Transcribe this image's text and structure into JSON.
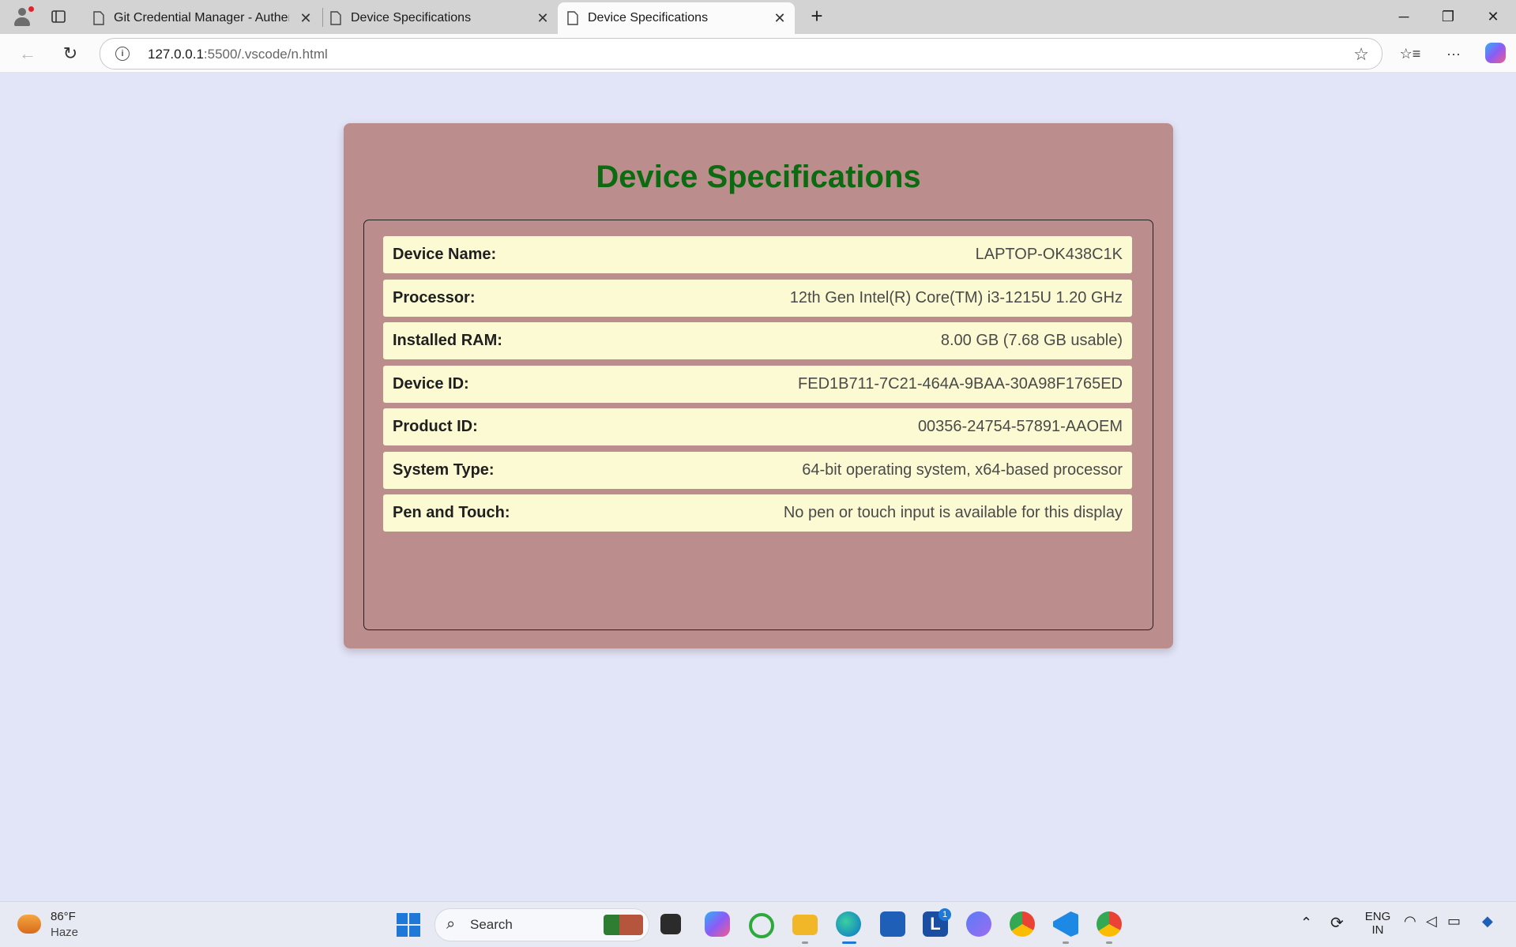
{
  "browser": {
    "tabs": [
      {
        "label": "Git Credential Manager - Authent",
        "active": false
      },
      {
        "label": "Device Specifications",
        "active": false
      },
      {
        "label": "Device Specifications",
        "active": true
      }
    ],
    "url_host": "127.0.0.1",
    "url_rest": ":5500/.vscode/n.html",
    "icons": {
      "profile": "profile-avatar-icon",
      "tab_actions": "tab-actions-icon",
      "new_tab": "+",
      "minimize": "─",
      "restore": "❐",
      "close": "✕",
      "back": "←",
      "refresh": "↻",
      "info": "i",
      "favorite": "☆",
      "favorites": "☆≡",
      "more": "···"
    }
  },
  "page": {
    "title": "Device Specifications",
    "specs": [
      {
        "key": "Device Name:",
        "value": "LAPTOP-OK438C1K"
      },
      {
        "key": "Processor:",
        "value": "12th Gen Intel(R) Core(TM) i3-1215U 1.20 GHz"
      },
      {
        "key": "Installed RAM:",
        "value": "8.00 GB (7.68 GB usable)"
      },
      {
        "key": "Device ID:",
        "value": "FED1B711-7C21-464A-9BAA-30A98F1765ED"
      },
      {
        "key": "Product ID:",
        "value": "00356-24754-57891-AAOEM"
      },
      {
        "key": "System Type:",
        "value": "64-bit operating system, x64-based processor"
      },
      {
        "key": "Pen and Touch:",
        "value": "No pen or touch input is available for this display"
      }
    ],
    "colors": {
      "background": "#e2e4f7",
      "card": "#bc8d8d",
      "title": "#0c6a10",
      "row": "#fbfad2"
    }
  },
  "taskbar": {
    "weather_temp": "86°F",
    "weather_condition": "Haze",
    "search_label": "Search",
    "language_top": "ENG",
    "language_bottom": "IN",
    "lexi_badge": "1",
    "lexi_letter": "L"
  }
}
